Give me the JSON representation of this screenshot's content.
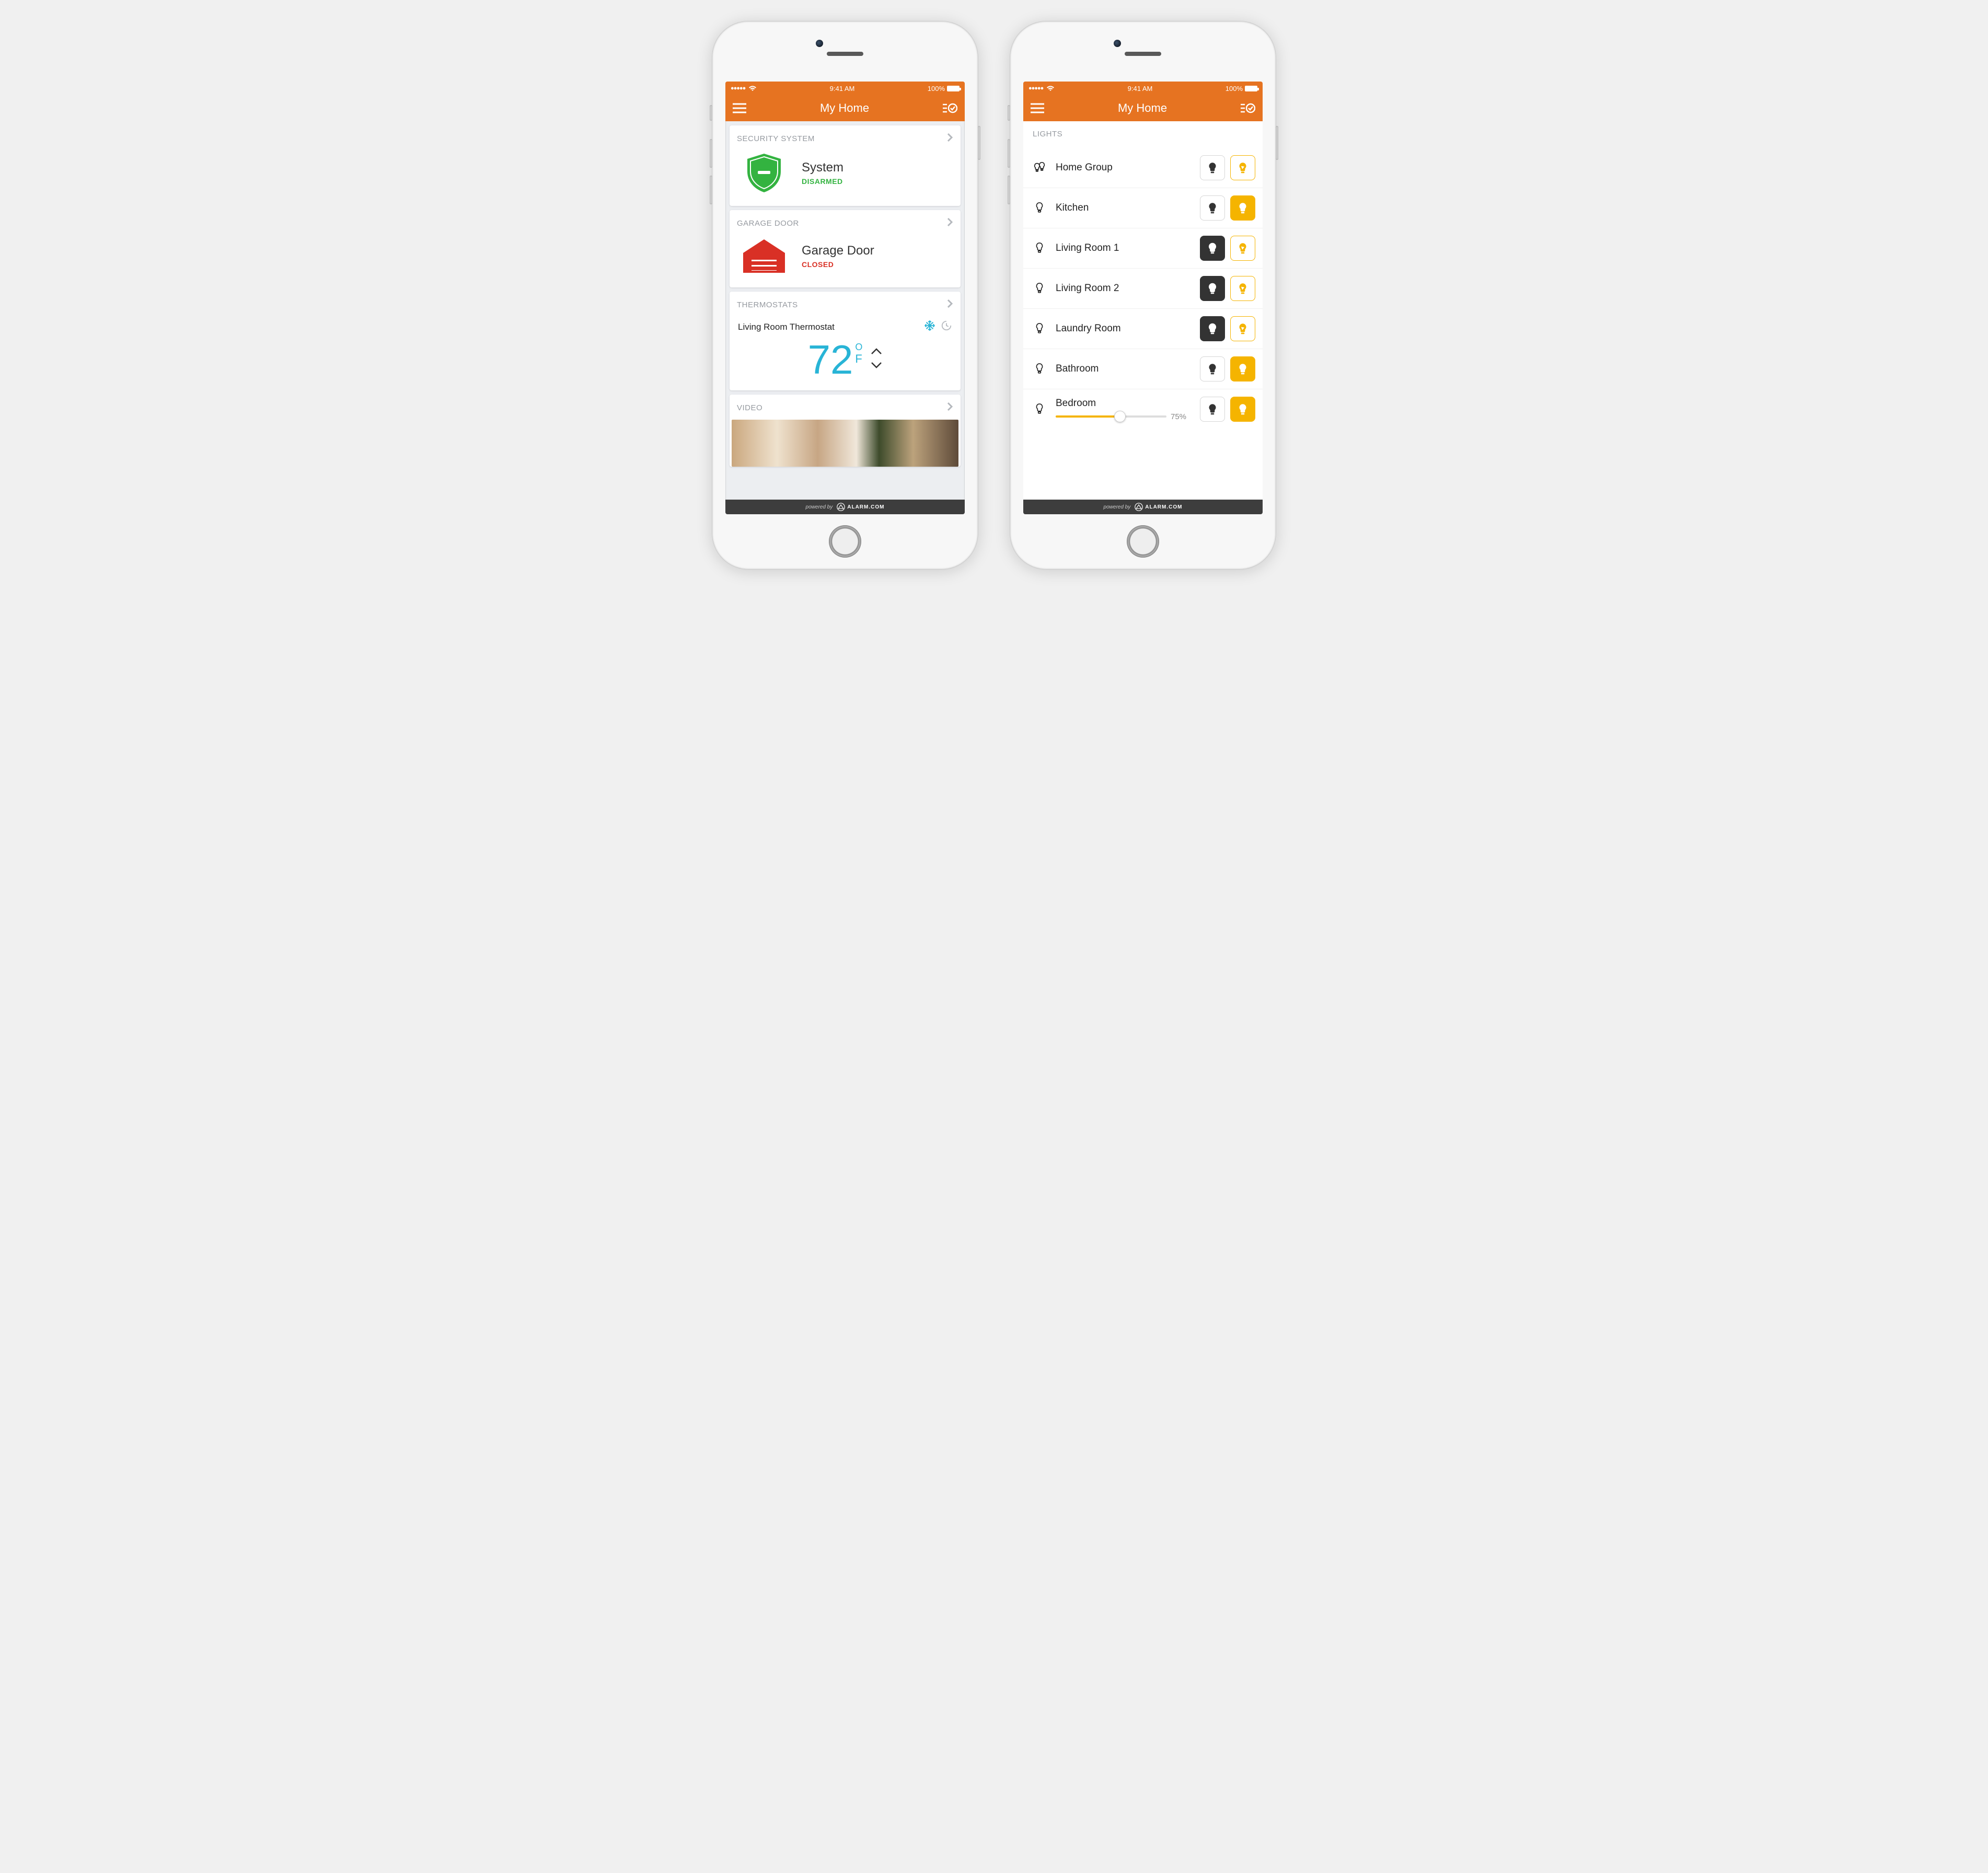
{
  "statusbar": {
    "time": "9:41 AM",
    "battery_text": "100%"
  },
  "nav": {
    "title": "My Home"
  },
  "left": {
    "security": {
      "header": "SECURITY SYSTEM",
      "device": "System",
      "status": "DISARMED"
    },
    "garage": {
      "header": "GARAGE DOOR",
      "device": "Garage Door",
      "status": "CLOSED"
    },
    "thermostats": {
      "header": "THERMOSTATS",
      "device": "Living Room Thermostat",
      "temperature": "72",
      "unit_deg": "O",
      "unit_f": "F"
    },
    "video": {
      "header": "VIDEO"
    }
  },
  "right": {
    "section": "LIGHTS",
    "rows": [
      {
        "name": "Home Group",
        "type": "group",
        "off_state": "idle",
        "on_state": "outline"
      },
      {
        "name": "Kitchen",
        "type": "single",
        "off_state": "idle",
        "on_state": "active"
      },
      {
        "name": "Living Room 1",
        "type": "single",
        "off_state": "active",
        "on_state": "outline"
      },
      {
        "name": "Living Room 2",
        "type": "single",
        "off_state": "active",
        "on_state": "outline"
      },
      {
        "name": "Laundry Room",
        "type": "single",
        "off_state": "active",
        "on_state": "outline"
      },
      {
        "name": "Bathroom",
        "type": "single",
        "off_state": "idle",
        "on_state": "active"
      },
      {
        "name": "Bedroom",
        "type": "single",
        "off_state": "idle",
        "on_state": "active",
        "slider": 58,
        "pct_label": "75%"
      }
    ]
  },
  "footer": {
    "powered": "powered by",
    "brand": "ALARM.COM"
  }
}
